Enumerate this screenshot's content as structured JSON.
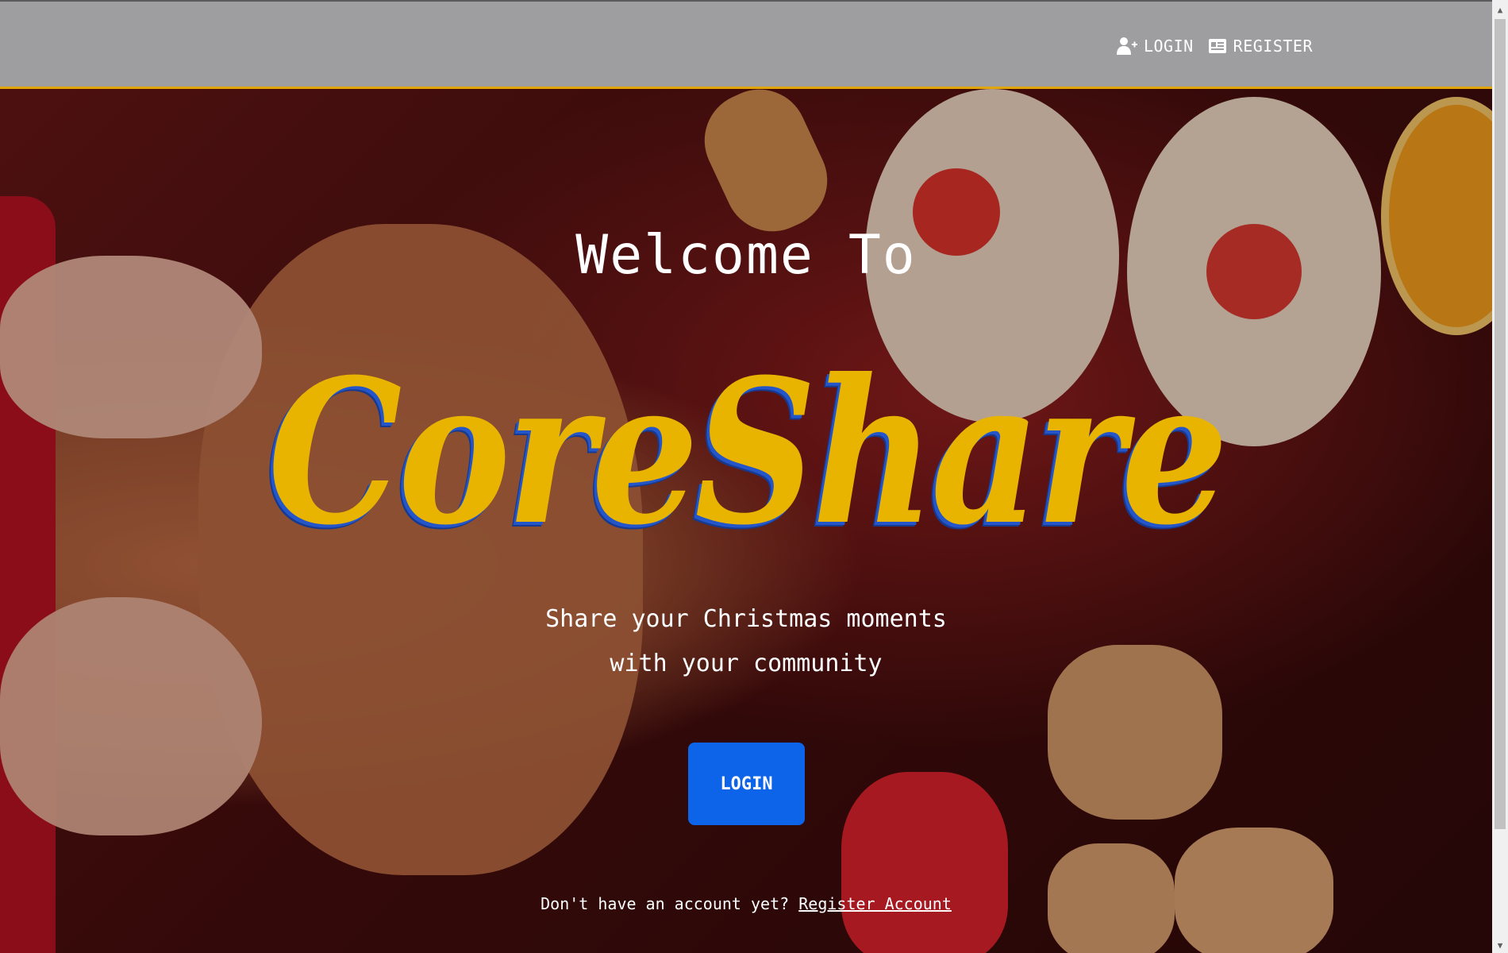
{
  "nav": {
    "login_label": "LOGIN",
    "register_label": "REGISTER",
    "login_icon": "user-plus-icon",
    "register_icon": "id-card-icon"
  },
  "hero": {
    "welcome": "Welcome To",
    "brand": "CoreShare",
    "tagline_line1": "Share your Christmas moments",
    "tagline_line2": "with your community",
    "login_button": "LOGIN",
    "no_account_text": "Don't have an account yet?",
    "register_link": "Register Account"
  },
  "colors": {
    "navbar_bg": "#9e9d9f",
    "navbar_border": "#e2a400",
    "brand_yellow": "#e8b400",
    "brand_shadow": "#2456c9",
    "button_blue": "#0d64e8"
  }
}
